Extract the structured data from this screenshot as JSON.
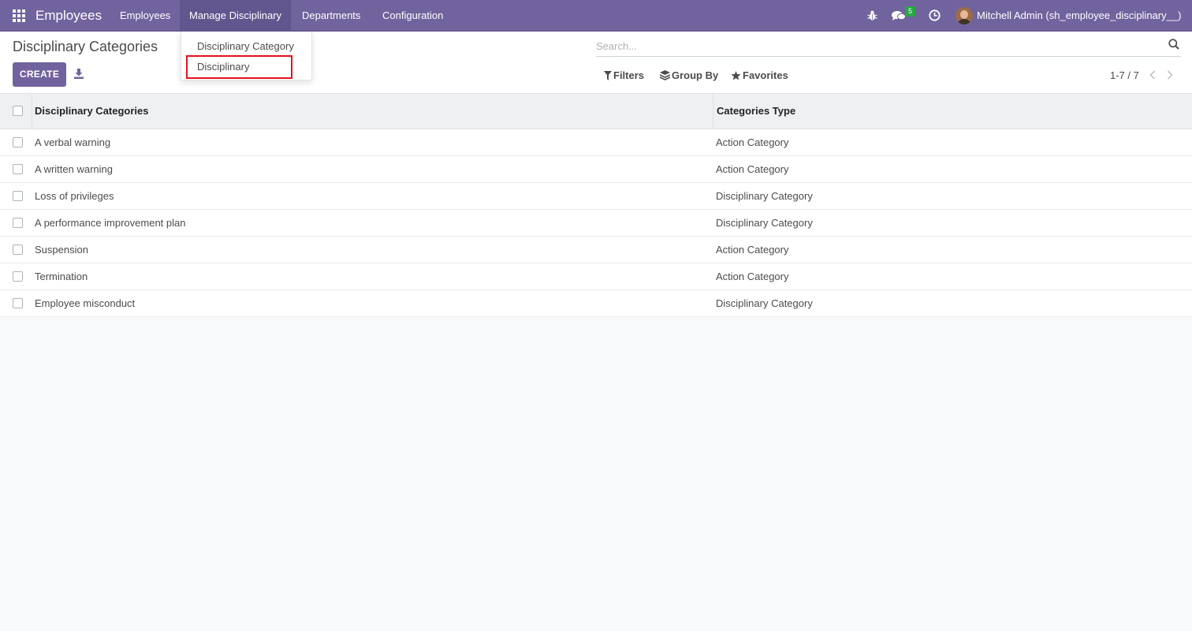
{
  "navbar": {
    "brand": "Employees",
    "menu": [
      {
        "label": "Employees"
      },
      {
        "label": "Manage Disciplinary"
      },
      {
        "label": "Departments"
      },
      {
        "label": "Configuration"
      }
    ],
    "messages_badge": "5",
    "user_name": "Mitchell Admin (sh_employee_disciplinary__)",
    "icons": [
      "apps-grid-icon",
      "bug-icon",
      "chat-icon",
      "clock-icon",
      "avatar"
    ]
  },
  "dropdown": {
    "items": [
      {
        "label": "Disciplinary Category"
      },
      {
        "label": "Disciplinary"
      }
    ],
    "highlighted": "Disciplinary"
  },
  "control_panel": {
    "title": "Disciplinary Categories",
    "create_label": "CREATE",
    "search_placeholder": "Search...",
    "filters_label": "Filters",
    "group_by_label": "Group By",
    "favorites_label": "Favorites",
    "pager": "1-7 / 7"
  },
  "table": {
    "columns": [
      "Disciplinary Categories",
      "Categories Type"
    ],
    "rows": [
      {
        "name": "A verbal warning",
        "type": "Action Category"
      },
      {
        "name": "A written warning",
        "type": "Action Category"
      },
      {
        "name": "Loss of privileges",
        "type": "Disciplinary Category"
      },
      {
        "name": "A performance improvement plan",
        "type": "Disciplinary Category"
      },
      {
        "name": "Suspension",
        "type": "Action Category"
      },
      {
        "name": "Termination",
        "type": "Action Category"
      },
      {
        "name": "Employee misconduct",
        "type": "Disciplinary Category"
      }
    ]
  },
  "colors": {
    "navbar": "#71639e",
    "primary_button": "#71639e",
    "badge": "#28a745",
    "highlight": "#e3121d"
  }
}
